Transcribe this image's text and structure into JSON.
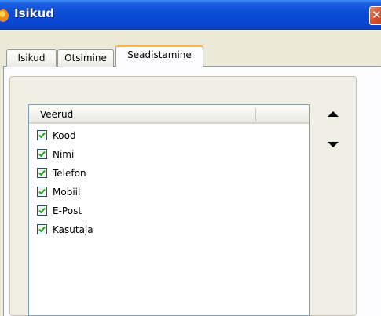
{
  "window": {
    "title": "Isikud"
  },
  "tabs": [
    {
      "label": "Isikud"
    },
    {
      "label": "Otsimine"
    },
    {
      "label": "Seadistamine"
    }
  ],
  "list": {
    "header": "Veerud",
    "items": [
      {
        "label": "Kood",
        "checked": true
      },
      {
        "label": "Nimi",
        "checked": true
      },
      {
        "label": "Telefon",
        "checked": true
      },
      {
        "label": "Mobiil",
        "checked": true
      },
      {
        "label": "E-Post",
        "checked": true
      },
      {
        "label": "Kasutaja",
        "checked": true
      }
    ]
  },
  "icons": {
    "move_up": "triangle-up-icon",
    "move_down": "triangle-down-icon",
    "close": "close-icon",
    "app": "app-logo-icon"
  },
  "colors": {
    "titlebar": "#0a4bd6",
    "active_tab_accent": "#f8b640",
    "checkmark": "#21a121"
  }
}
